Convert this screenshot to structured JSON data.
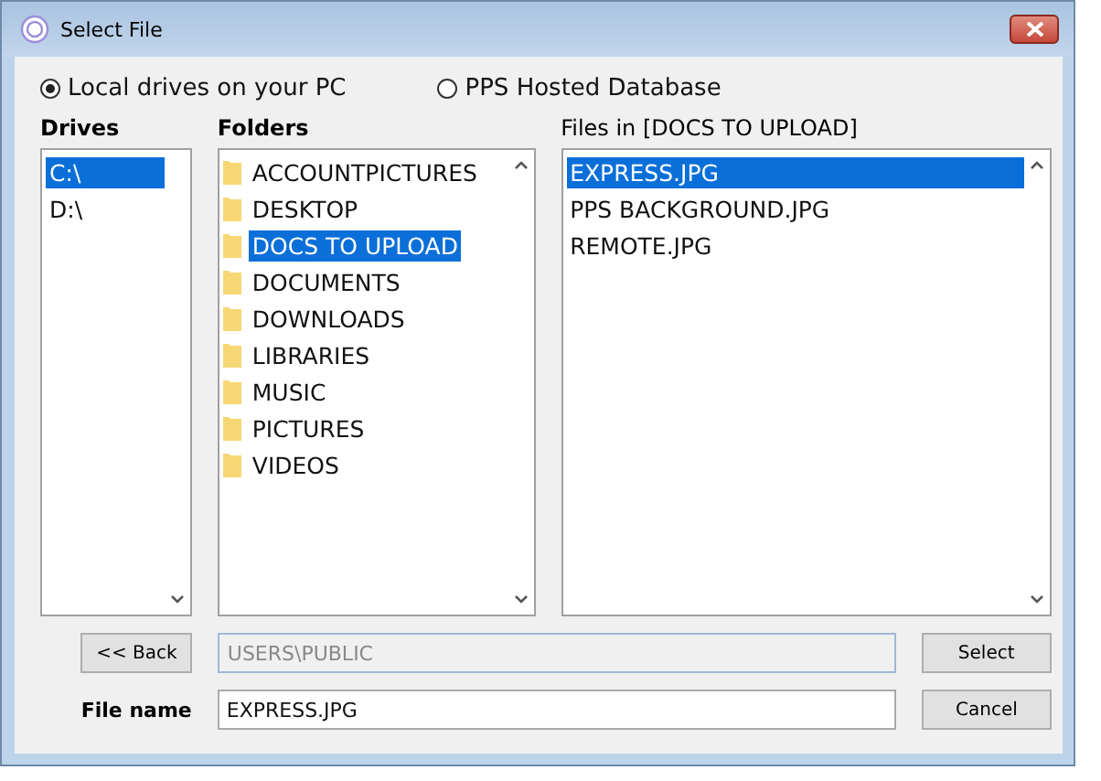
{
  "window": {
    "title": "Select File"
  },
  "sources": [
    {
      "label": "Local drives on your PC",
      "selected": true
    },
    {
      "label": "PPS Hosted Database",
      "selected": false
    }
  ],
  "drives": {
    "heading": "Drives",
    "items": [
      {
        "label": "C:\\",
        "selected": true
      },
      {
        "label": "D:\\",
        "selected": false
      }
    ]
  },
  "folders": {
    "heading": "Folders",
    "items": [
      {
        "label": "ACCOUNTPICTURES",
        "selected": false
      },
      {
        "label": "DESKTOP",
        "selected": false
      },
      {
        "label": "DOCS TO UPLOAD",
        "selected": true
      },
      {
        "label": "DOCUMENTS",
        "selected": false
      },
      {
        "label": "DOWNLOADS",
        "selected": false
      },
      {
        "label": "LIBRARIES",
        "selected": false
      },
      {
        "label": "MUSIC",
        "selected": false
      },
      {
        "label": "PICTURES",
        "selected": false
      },
      {
        "label": "VIDEOS",
        "selected": false
      }
    ]
  },
  "files": {
    "heading": "Files in [DOCS TO UPLOAD]",
    "items": [
      {
        "label": "EXPRESS.JPG",
        "selected": true
      },
      {
        "label": "PPS BACKGROUND.JPG",
        "selected": false
      },
      {
        "label": "REMOTE.JPG",
        "selected": false
      }
    ]
  },
  "back_button": "<< Back",
  "path_field": {
    "value": "USERS\\PUBLIC",
    "disabled": true
  },
  "file_name": {
    "label": "File name",
    "value": "EXPRESS.JPG"
  },
  "buttons": [
    "Select",
    "Cancel"
  ]
}
